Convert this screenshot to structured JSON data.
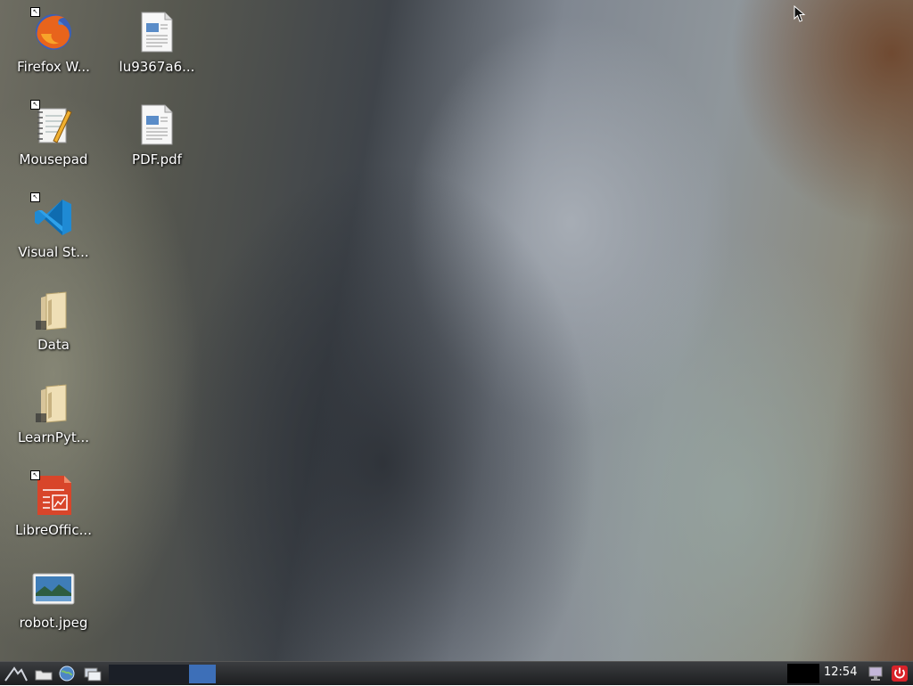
{
  "desktop": {
    "icons": [
      {
        "label": "Firefox W...",
        "icon": "firefox-icon"
      },
      {
        "label": "lu9367a6...",
        "icon": "image-file-icon"
      },
      {
        "label": "Mousepad",
        "icon": "notepad-icon"
      },
      {
        "label": "PDF.pdf",
        "icon": "pdf-file-icon"
      },
      {
        "label": "Visual St...",
        "icon": "vscode-icon"
      },
      {
        "label": "Data",
        "icon": "folder-icon"
      },
      {
        "label": "LearnPyt...",
        "icon": "folder-icon"
      },
      {
        "label": "LibreOffic...",
        "icon": "libreoffice-impress-icon"
      },
      {
        "label": "robot.jpeg",
        "icon": "image-icon"
      }
    ]
  },
  "taskbar": {
    "clock": "12:54",
    "workspaces": 4,
    "active_workspace": 4,
    "colors": {
      "active_workspace": "#3d6fb8",
      "power": "#d9232a"
    }
  }
}
